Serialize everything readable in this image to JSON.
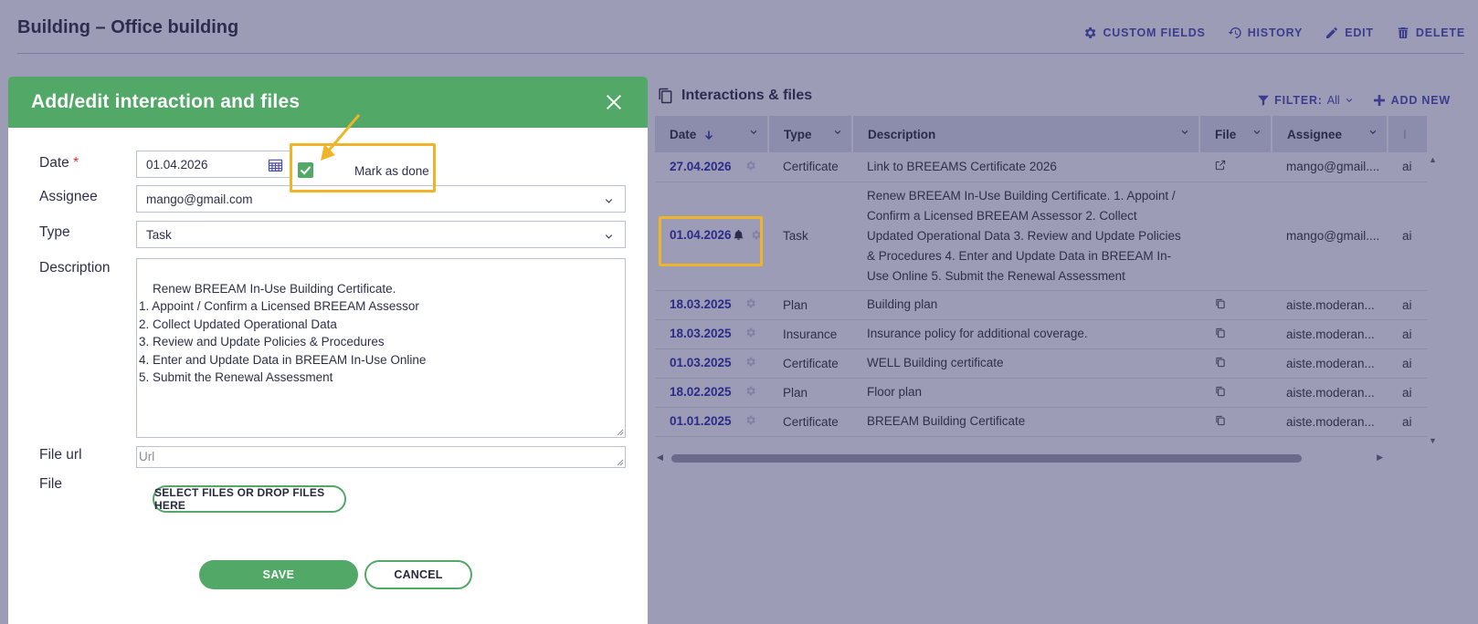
{
  "page": {
    "title": "Building – Office building",
    "actions": [
      {
        "label": "CUSTOM FIELDS",
        "icon": "gear-icon"
      },
      {
        "label": "HISTORY",
        "icon": "history-icon"
      },
      {
        "label": "EDIT",
        "icon": "pencil-icon"
      },
      {
        "label": "DELETE",
        "icon": "trash-icon"
      }
    ]
  },
  "panel": {
    "title": "Interactions & files",
    "filter_label": "FILTER:",
    "filter_value": "All",
    "add_new_label": "ADD NEW",
    "columns": [
      "Date",
      "Type",
      "Description",
      "File",
      "Assignee",
      "I"
    ],
    "rows": [
      {
        "date": "27.04.2026",
        "type": "Certificate",
        "description": "Link to BREEAMS Certificate 2026",
        "file_icon": "external-link-icon",
        "assignee": "mango@gmail....",
        "extra": "ai"
      },
      {
        "date": "01.04.2026",
        "bell": true,
        "type": "Task",
        "description": "Renew BREEAM In-Use Building Certificate. 1. Appoint / Confirm a Licensed BREEAM Assessor 2. Collect Updated Operational Data 3. Review and Update Policies & Procedures 4. Enter and Update Data in BREEAM In-Use Online 5. Submit the Renewal Assessment",
        "file_icon": "",
        "assignee": "mango@gmail....",
        "extra": "ai"
      },
      {
        "date": "18.03.2025",
        "type": "Plan",
        "description": "Building plan",
        "file_icon": "copy-icon",
        "assignee": "aiste.moderan...",
        "extra": "ai"
      },
      {
        "date": "18.03.2025",
        "type": "Insurance",
        "description": "Insurance policy for additional coverage.",
        "file_icon": "copy-icon",
        "assignee": "aiste.moderan...",
        "extra": "ai"
      },
      {
        "date": "01.03.2025",
        "type": "Certificate",
        "description": "WELL Building certificate",
        "file_icon": "copy-icon",
        "assignee": "aiste.moderan...",
        "extra": "ai"
      },
      {
        "date": "18.02.2025",
        "type": "Plan",
        "description": "Floor plan",
        "file_icon": "copy-icon",
        "assignee": "aiste.moderan...",
        "extra": "ai"
      },
      {
        "date": "01.01.2025",
        "type": "Certificate",
        "description": "BREEAM Building Certificate",
        "file_icon": "copy-icon",
        "assignee": "aiste.moderan...",
        "extra": "ai"
      }
    ]
  },
  "modal": {
    "title": "Add/edit interaction and files",
    "date_label": "Date",
    "required_mark": "*",
    "date_value": "01.04.2026",
    "mark_done_label": "Mark as done",
    "mark_done_checked": true,
    "assignee_label": "Assignee",
    "assignee_value": "mango@gmail.com",
    "type_label": "Type",
    "type_value": "Task",
    "description_label": "Description",
    "description_value": "Renew BREEAM In-Use Building Certificate.\n1. Appoint / Confirm a Licensed BREEAM Assessor\n2. Collect Updated Operational Data\n3. Review and Update Policies & Procedures\n4. Enter and Update Data in BREEAM In-Use Online\n5. Submit the Renewal Assessment",
    "file_url_label": "File url",
    "file_url_placeholder": "Url",
    "file_label": "File",
    "select_files_label": "SELECT FILES OR DROP FILES HERE",
    "save_label": "SAVE",
    "cancel_label": "CANCEL"
  },
  "colors": {
    "accent_green": "#52a866",
    "highlight": "#f0b429",
    "link_blue": "#2b2b8a"
  }
}
